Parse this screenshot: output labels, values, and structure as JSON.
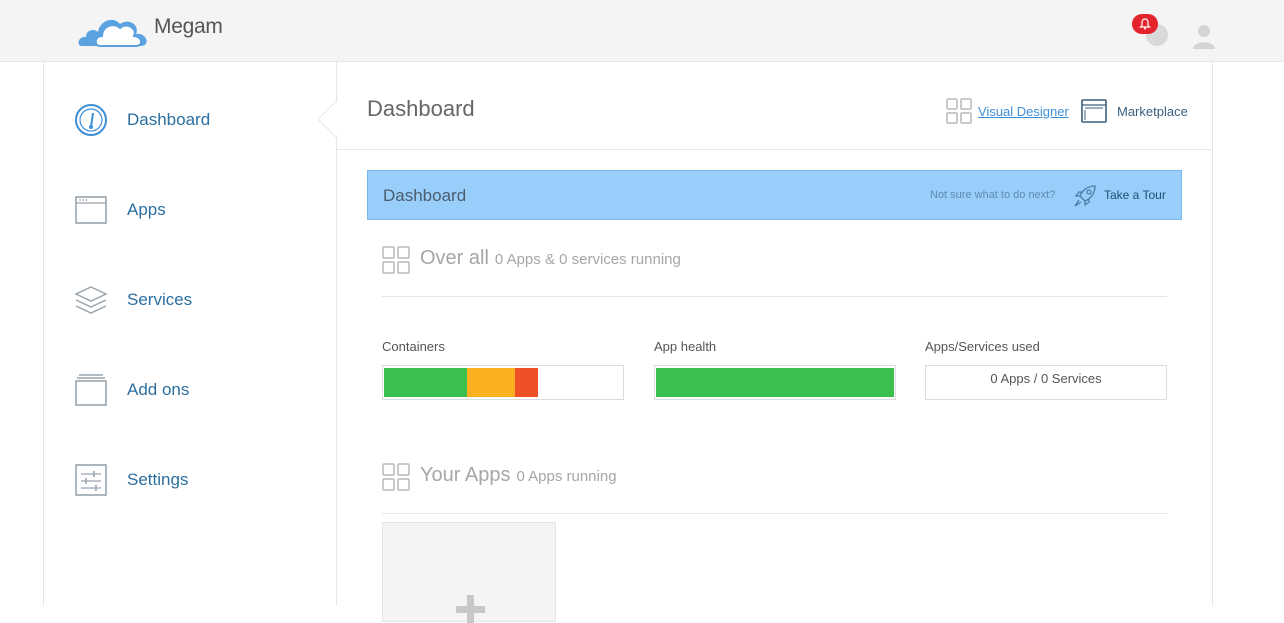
{
  "brand": {
    "name": "Megam"
  },
  "topbar": {
    "notifications_icon": "bell-icon",
    "globe_icon": "globe-icon",
    "user_icon": "user-icon"
  },
  "sidebar": {
    "items": [
      {
        "label": "Dashboard",
        "icon": "speedometer-icon"
      },
      {
        "label": "Apps",
        "icon": "window-icon"
      },
      {
        "label": "Services",
        "icon": "layers-icon"
      },
      {
        "label": "Add ons",
        "icon": "stack-box-icon"
      },
      {
        "label": "Settings",
        "icon": "sliders-icon"
      }
    ]
  },
  "header": {
    "title": "Dashboard",
    "visual_designer": "Visual Designer",
    "marketplace": "Marketplace"
  },
  "banner": {
    "title": "Dashboard",
    "hint": "Not sure what to do next?",
    "tour": "Take a Tour"
  },
  "overall": {
    "title": "Over all",
    "subtitle": "0 Apps & 0 services running"
  },
  "stats": {
    "containers_label": "Containers",
    "containers_segments": [
      {
        "color": "#3bbf4f",
        "fraction": 0.35
      },
      {
        "color": "#fbb021",
        "fraction": 0.2
      },
      {
        "color": "#f05027",
        "fraction": 0.095
      }
    ],
    "app_health_label": "App health",
    "app_health_fraction": 1.0,
    "app_health_color": "#3bbf4f",
    "used_label": "Apps/Services used",
    "used_value": "0 Apps / 0 Services"
  },
  "your_apps": {
    "title": "Your Apps",
    "subtitle": "0 Apps running"
  },
  "colors": {
    "accent": "#2a6fa0",
    "banner": "#99cdfa",
    "link": "#3d8fd8"
  }
}
